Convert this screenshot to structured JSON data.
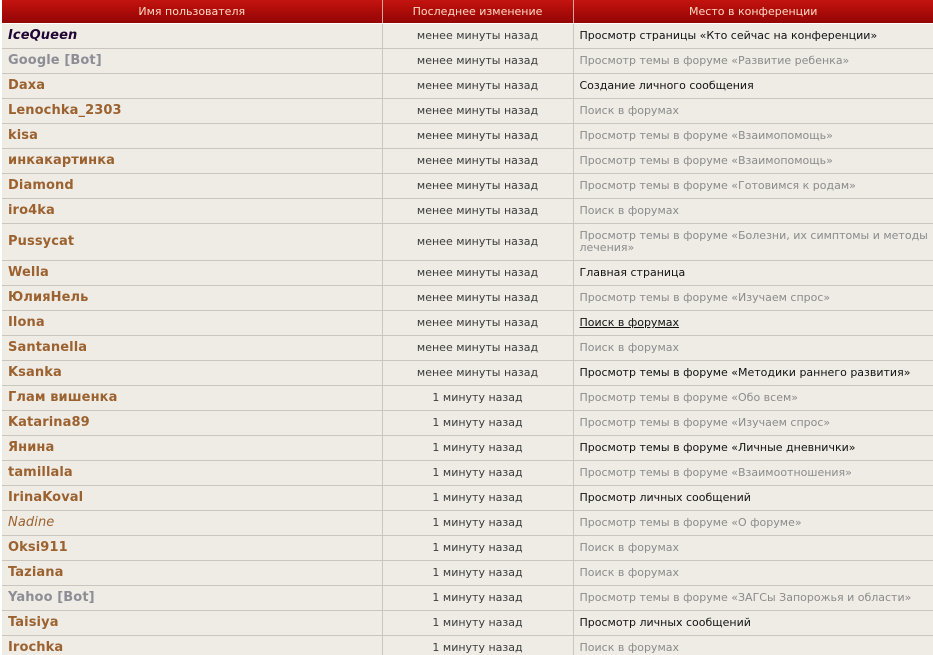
{
  "header": {
    "col_user": "Имя пользователя",
    "col_last_change": "Последнее изменение",
    "col_location": "Место в конференции"
  },
  "colors": {
    "header_bg": "#b20f0b",
    "header_text": "#ffd9c6",
    "row_bg": "#efece6",
    "username": "#9b6230",
    "admin": "#200434",
    "bot": "#8d8d95"
  },
  "rows": [
    {
      "user": "IceQueen",
      "time": "менее минуты назад",
      "place": "Просмотр страницы «Кто сейчас на конференции»"
    },
    {
      "user": "Google [Bot]",
      "time": "менее минуты назад",
      "place": "Просмотр темы в форуме «Развитие ребенка»"
    },
    {
      "user": "Daxa",
      "time": "менее минуты назад",
      "place": "Создание личного сообщения"
    },
    {
      "user": "Lenochka_2303",
      "time": "менее минуты назад",
      "place": "Поиск в форумах"
    },
    {
      "user": "kisa",
      "time": "менее минуты назад",
      "place": "Просмотр темы в форуме «Взаимопомощь»"
    },
    {
      "user": "инкакартинка",
      "time": "менее минуты назад",
      "place": "Просмотр темы в форуме «Взаимопомощь»"
    },
    {
      "user": "Diamond",
      "time": "менее минуты назад",
      "place": "Просмотр темы в форуме «Готовимся к родам»"
    },
    {
      "user": "iro4ka",
      "time": "менее минуты назад",
      "place": "Поиск в форумах"
    },
    {
      "user": "Pussycat",
      "time": "менее минуты назад",
      "place": "Просмотр темы в форуме «Болезни, их симптомы и методы лечения»"
    },
    {
      "user": "Wella",
      "time": "менее минуты назад",
      "place": "Главная страница"
    },
    {
      "user": "ЮлияНель",
      "time": "менее минуты назад",
      "place": "Просмотр темы в форуме «Изучаем спрос»"
    },
    {
      "user": "Ilona",
      "time": "менее минуты назад",
      "place": "Поиск в форумах"
    },
    {
      "user": "Santanella",
      "time": "менее минуты назад",
      "place": "Поиск в форумах"
    },
    {
      "user": "Ksanka",
      "time": "менее минуты назад",
      "place": "Просмотр темы в форуме «Методики раннего развития»"
    },
    {
      "user": "Глам вишенка",
      "time": "1 минуту назад",
      "place": "Просмотр темы в форуме «Обо всем»"
    },
    {
      "user": "Katarina89",
      "time": "1 минуту назад",
      "place": "Просмотр темы в форуме «Изучаем спрос»"
    },
    {
      "user": "Янина",
      "time": "1 минуту назад",
      "place": "Просмотр темы в форуме «Личные дневнички»"
    },
    {
      "user": "tamillala",
      "time": "1 минуту назад",
      "place": "Просмотр темы в форуме «Взаимоотношения»"
    },
    {
      "user": "IrinaKoval",
      "time": "1 минуту назад",
      "place": "Просмотр личных сообщений"
    },
    {
      "user": "Nadine",
      "time": "1 минуту назад",
      "place": "Просмотр темы в форуме «О форуме»"
    },
    {
      "user": "Oksi911",
      "time": "1 минуту назад",
      "place": "Поиск в форумах"
    },
    {
      "user": "Taziana",
      "time": "1 минуту назад",
      "place": "Поиск в форумах"
    },
    {
      "user": "Yahoo [Bot]",
      "time": "1 минуту назад",
      "place": "Просмотр темы в форуме «ЗАГСы Запорожья и области»"
    },
    {
      "user": "Taisiya",
      "time": "1 минуту назад",
      "place": "Просмотр личных сообщений"
    },
    {
      "user": "Irochka",
      "time": "1 минуту назад",
      "place": "Поиск в форумах"
    }
  ]
}
